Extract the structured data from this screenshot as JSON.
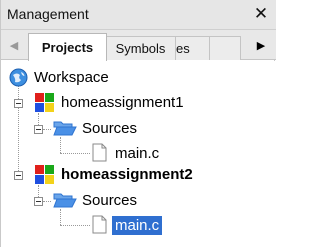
{
  "window": {
    "title": "Management",
    "close_glyph": "✕"
  },
  "tabs": [
    {
      "label": "Projects",
      "active": true
    },
    {
      "label": "Symbols",
      "active": false
    },
    {
      "label": "Files",
      "active": false
    }
  ],
  "tab_scroll": {
    "left_glyph": "◀",
    "right_glyph": "▶"
  },
  "tree": {
    "root": {
      "label": "Workspace",
      "icon": "workspace-globe-icon"
    },
    "projects": [
      {
        "label": "homeassignment1",
        "bold": false,
        "icon": "project-colored-icon",
        "folder": {
          "label": "Sources",
          "icon": "folder-open-icon",
          "files": [
            {
              "label": "main.c",
              "selected": false,
              "icon": "file-icon"
            }
          ]
        }
      },
      {
        "label": "homeassignment2",
        "bold": true,
        "icon": "project-colored-icon",
        "folder": {
          "label": "Sources",
          "icon": "folder-open-icon",
          "files": [
            {
              "label": "main.c",
              "selected": true,
              "icon": "file-icon"
            }
          ]
        }
      }
    ]
  },
  "colors": {
    "selection": "#2f6fd0",
    "titlebar": "#e6e6e6",
    "folder_blue": "#2f74d0",
    "project_red": "#e0201b",
    "project_green": "#1aa81a",
    "project_blue": "#1f4fe0",
    "project_yellow": "#f3d21a"
  }
}
